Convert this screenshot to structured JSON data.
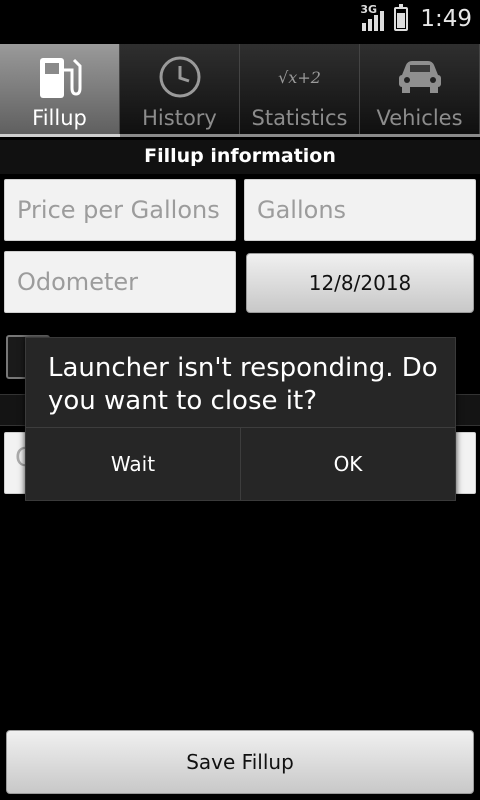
{
  "status": {
    "network": "3G",
    "time": "1:49"
  },
  "tabs": [
    {
      "label": "Fillup",
      "icon": "fuel-pump-icon",
      "active": true
    },
    {
      "label": "History",
      "icon": "clock-icon"
    },
    {
      "label": "Statistics",
      "icon": "sqrt-formula-icon",
      "formula": "√x+2"
    },
    {
      "label": "Vehicles",
      "icon": "car-icon"
    }
  ],
  "form": {
    "section_title": "Fillup information",
    "price_placeholder": "Price per Gallons",
    "gallons_placeholder": "Gallons",
    "odometer_placeholder": "Odometer",
    "date_value": "12/8/2018",
    "partial_placeholder": "C"
  },
  "dialog": {
    "message": "Launcher isn't responding. Do you want to close it?",
    "wait_label": "Wait",
    "ok_label": "OK"
  },
  "footer": {
    "save_label": "Save Fillup"
  }
}
